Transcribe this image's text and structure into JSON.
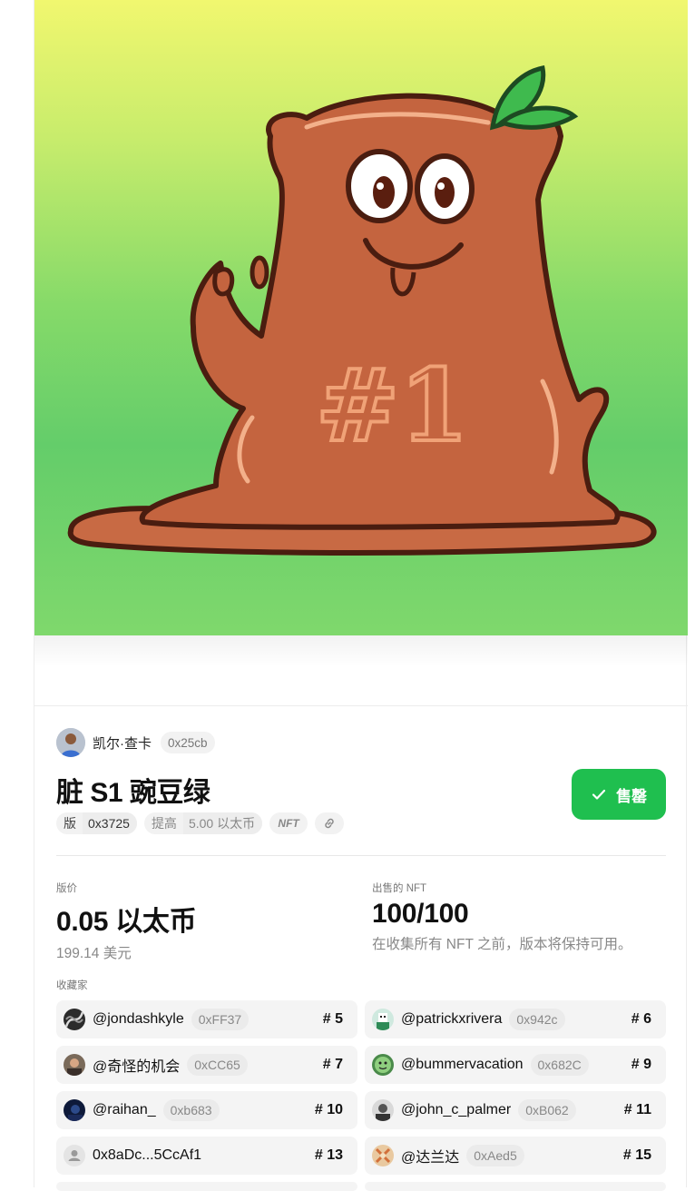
{
  "creator": {
    "name": "凯尔·查卡",
    "address": "0x25cb"
  },
  "nft": {
    "title": "脏 S1 豌豆绿",
    "edition_label": "版",
    "edition_address": "0x3725",
    "raise_label": "提高",
    "raise_value": "5.00 以太币",
    "nft_badge": "NFT"
  },
  "status_button": {
    "label": "售罄"
  },
  "stats": {
    "price": {
      "label": "版价",
      "value": "0.05 以太币",
      "sub": "199.14 美元"
    },
    "sold": {
      "label": "出售的 NFT",
      "value": "100/100",
      "sub": "在收集所有 NFT 之前，版本将保持可用。"
    }
  },
  "collectors": {
    "label": "收藏家",
    "items": [
      {
        "name": "@jondashkyle",
        "address": "0xFF37",
        "number": "# 5"
      },
      {
        "name": "@patrickxrivera",
        "address": "0x942c",
        "number": "# 6"
      },
      {
        "name": "@奇怪的机会",
        "address": "0xCC65",
        "number": "# 7"
      },
      {
        "name": "@bummervacation",
        "address": "0x682C",
        "number": "# 9"
      },
      {
        "name": "@raihan_",
        "address": "0xb683",
        "number": "# 10"
      },
      {
        "name": "@john_c_palmer",
        "address": "0xB062",
        "number": "# 11"
      },
      {
        "name": "0x8aDc...5CcAf1",
        "address": "",
        "number": "# 13"
      },
      {
        "name": "@达兰达",
        "address": "0xAed5",
        "number": "# 15"
      }
    ]
  },
  "colors": {
    "accent": "#1fbf4f",
    "pill_bg": "#f2f2f2",
    "row_bg": "#f4f4f4"
  }
}
